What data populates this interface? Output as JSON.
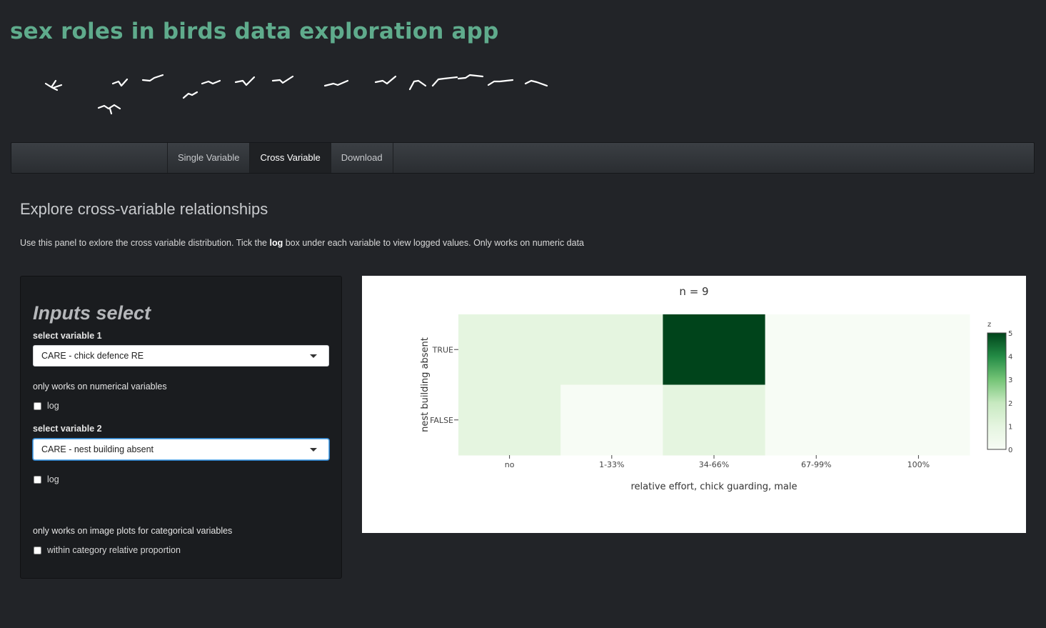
{
  "app": {
    "title": "sex roles in birds data exploration app"
  },
  "nav": {
    "tabs": [
      {
        "label": "Single Variable",
        "active": false
      },
      {
        "label": "Cross Variable",
        "active": true
      },
      {
        "label": "Download",
        "active": false
      }
    ]
  },
  "panel": {
    "heading": "Explore cross-variable relationships",
    "intro_pre": "Use this panel to exlore the cross variable distribution. Tick the ",
    "intro_bold": "log",
    "intro_post": " box under each variable to view logged values. Only works on numeric data"
  },
  "sidebar": {
    "title": "Inputs select",
    "var1_label": "select variable 1",
    "var1_value": "CARE - chick defence RE",
    "numeric_note": "only works on numerical variables",
    "log1_label": "log",
    "var2_label": "select variable 2",
    "var2_value": "CARE - nest building absent",
    "log2_label": "log",
    "image_note": "only works on image plots for categorical variables",
    "proportion_label": "within category relative proportion"
  },
  "chart_data": {
    "type": "heatmap",
    "title": "n = 9",
    "xlabel": "relative effort, chick guarding, male",
    "ylabel": "nest building absent",
    "x_categories": [
      "no",
      "1-33%",
      "34-66%",
      "67-99%",
      "100%"
    ],
    "y_categories": [
      "TRUE",
      "FALSE"
    ],
    "z": [
      [
        1,
        1,
        5,
        0,
        0
      ],
      [
        1,
        0,
        1,
        0,
        0
      ]
    ],
    "colorbar": {
      "title": "z",
      "min": 0,
      "max": 5,
      "ticks": [
        0,
        1,
        2,
        3,
        4,
        5
      ]
    },
    "colorscale": "Greens",
    "colors": {
      "low": "#f7fcf5",
      "high": "#00441b"
    }
  }
}
